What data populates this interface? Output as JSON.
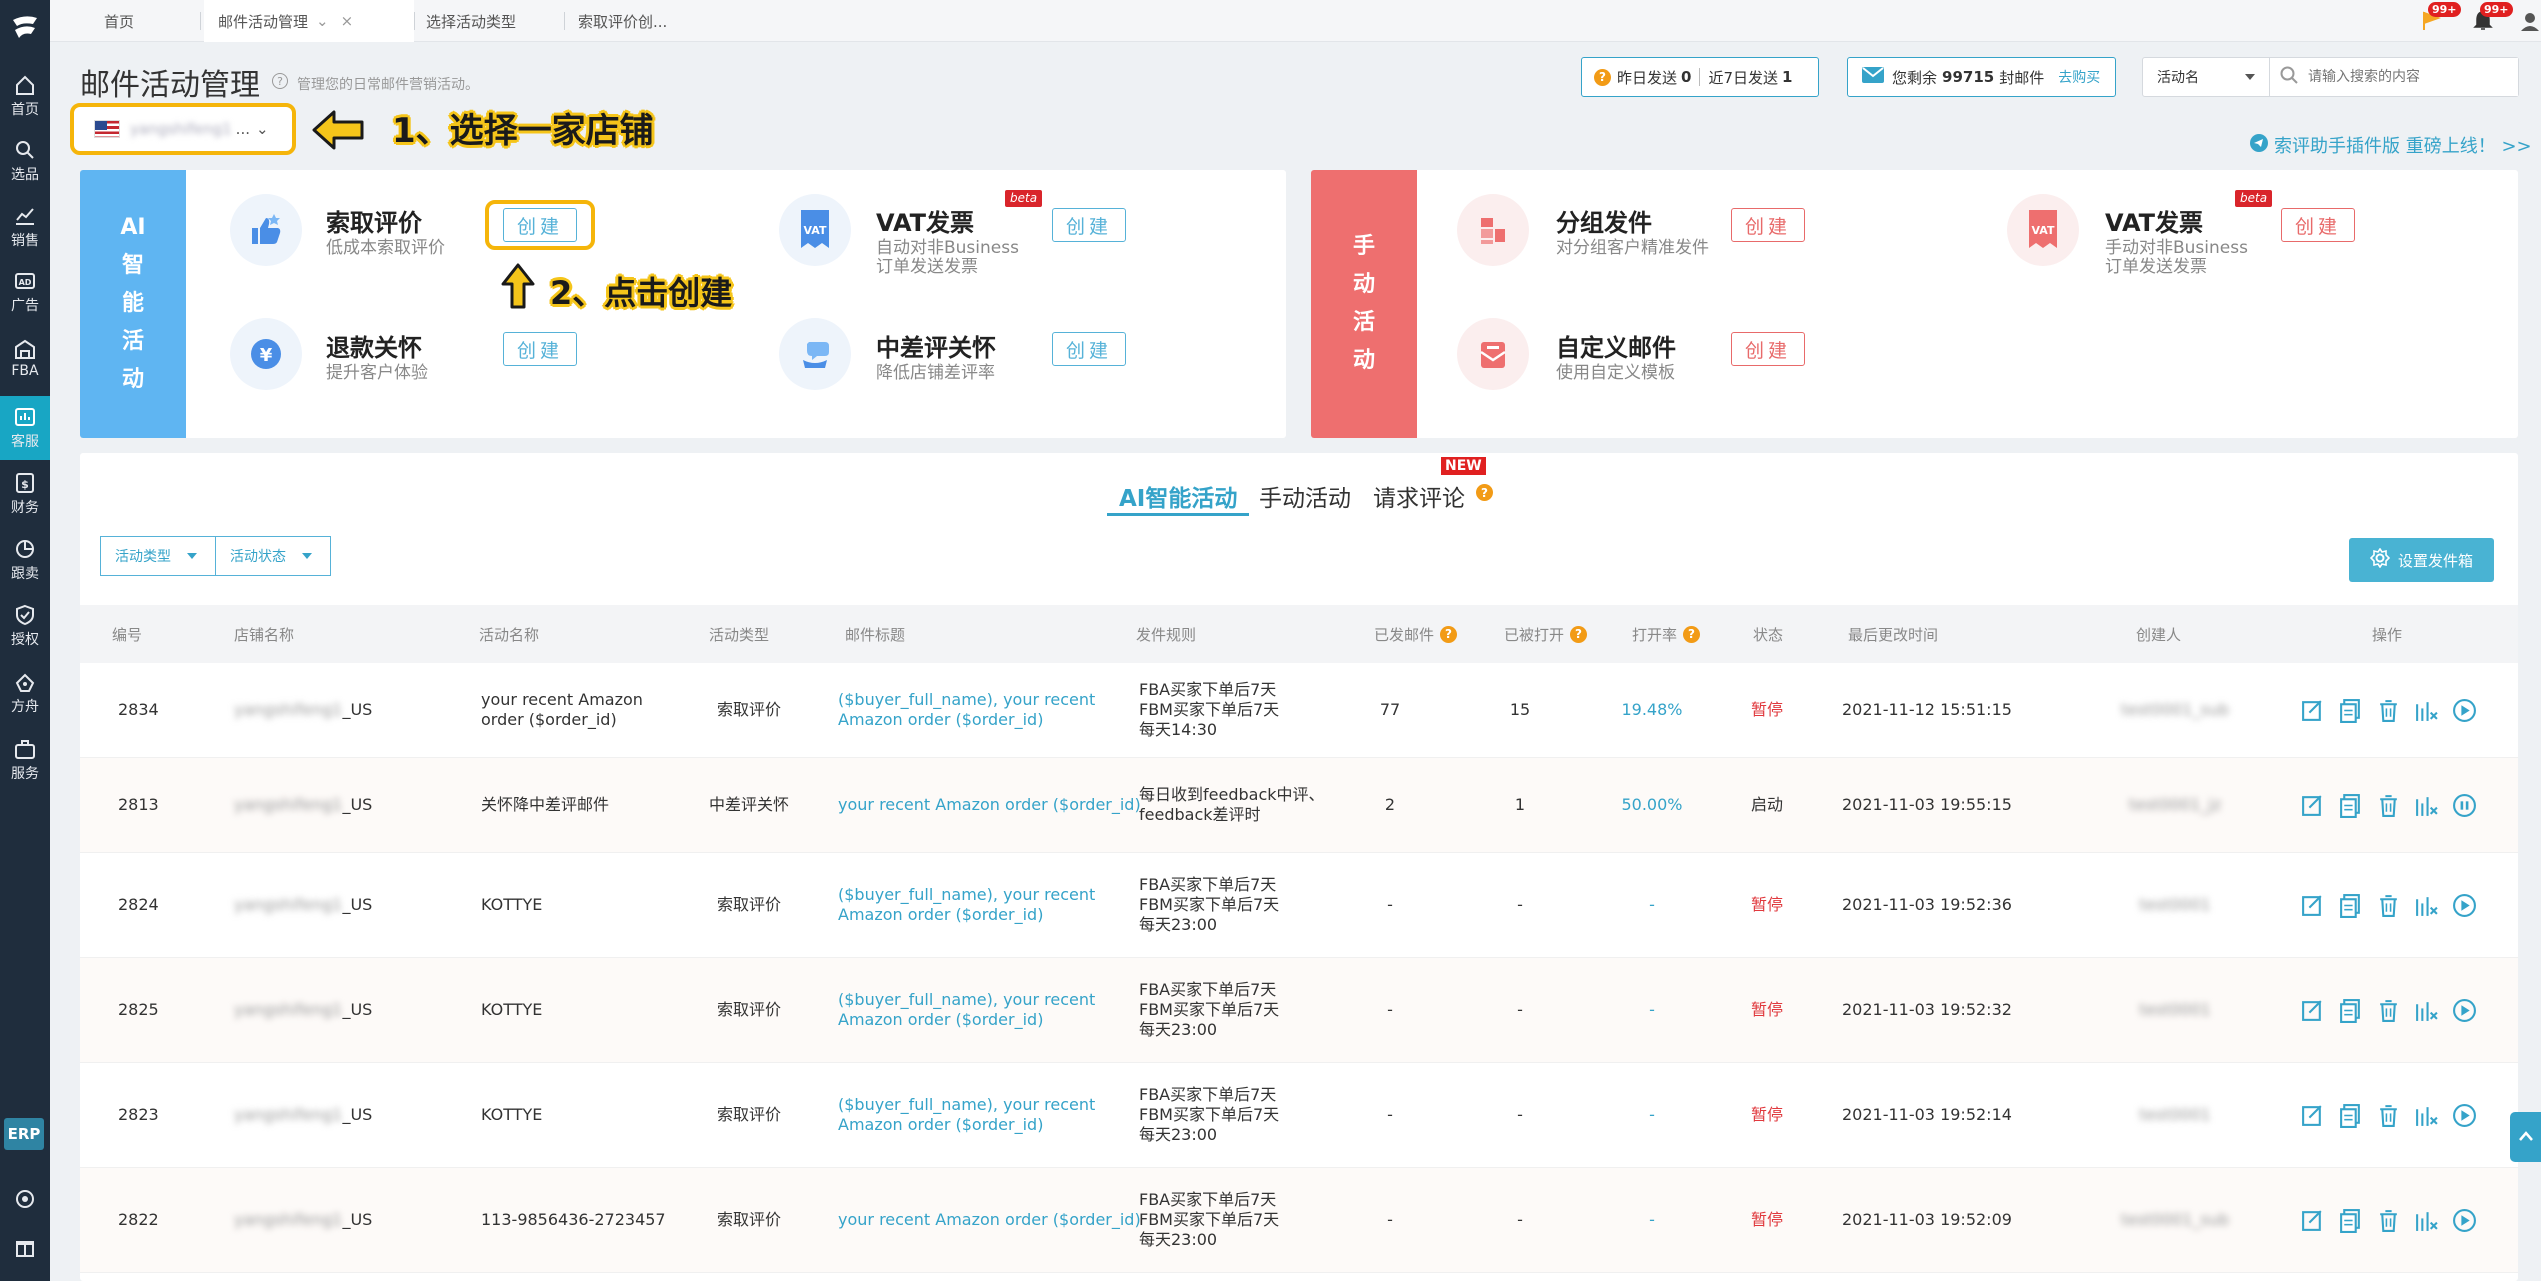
{
  "sidebar": {
    "items": [
      {
        "label": "首页",
        "icon": "home-icon"
      },
      {
        "label": "选品",
        "icon": "search-icon"
      },
      {
        "label": "销售",
        "icon": "chart-icon"
      },
      {
        "label": "广告",
        "icon": "ad-icon"
      },
      {
        "label": "FBA",
        "icon": "warehouse-icon"
      },
      {
        "label": "客服",
        "icon": "service-icon",
        "active": true
      },
      {
        "label": "财务",
        "icon": "finance-icon"
      },
      {
        "label": "跟卖",
        "icon": "pie-icon"
      },
      {
        "label": "授权",
        "icon": "shield-icon"
      },
      {
        "label": "方舟",
        "icon": "ark-icon"
      },
      {
        "label": "服务",
        "icon": "briefcase-icon"
      }
    ],
    "erp_label": "ERP"
  },
  "tabs": [
    {
      "label": "首页"
    },
    {
      "label": "邮件活动管理",
      "active": true
    },
    {
      "label": "选择活动类型"
    },
    {
      "label": "索取评价创..."
    }
  ],
  "notifications": {
    "flag_count": "99+",
    "bell_count": "99+"
  },
  "header": {
    "title": "邮件活动管理",
    "subtitle": "管理您的日常邮件营销活动。",
    "store_name": "yangshifeng1",
    "store_suffix": "..."
  },
  "annotations": {
    "step1": "1、选择一家店铺",
    "step2": "2、点击创建"
  },
  "stats": {
    "yesterday_label": "昨日发送",
    "yesterday_value": "0",
    "week_label": "近7日发送",
    "week_value": "1"
  },
  "mail_quota": {
    "prefix": "您剩余",
    "value": "99715",
    "suffix": "封邮件",
    "buy_label": "去购买"
  },
  "search": {
    "field": "活动名",
    "placeholder": "请输入搜索的内容"
  },
  "promo": "索评助手插件版 重磅上线！ >>",
  "ai_card": {
    "band": [
      "AI",
      "智",
      "能",
      "活",
      "动"
    ],
    "activities": [
      {
        "name": "索取评价",
        "desc": "低成本索取评价",
        "button": "创建"
      },
      {
        "name": "VAT发票",
        "desc": "自动对非Business\n订单发送发票",
        "button": "创建",
        "badge": "beta"
      },
      {
        "name": "退款关怀",
        "desc": "提升客户体验",
        "button": "创建"
      },
      {
        "name": "中差评关怀",
        "desc": "降低店铺差评率",
        "button": "创建"
      }
    ]
  },
  "manual_card": {
    "band": [
      "手",
      "动",
      "活",
      "动"
    ],
    "activities": [
      {
        "name": "分组发件",
        "desc": "对分组客户精准发件",
        "button": "创建"
      },
      {
        "name": "VAT发票",
        "desc": "手动对非Business\n订单发送发票",
        "button": "创建",
        "badge": "beta"
      },
      {
        "name": "自定义邮件",
        "desc": "使用自定义模板",
        "button": "创建"
      }
    ]
  },
  "category_tabs": [
    {
      "label": "AI智能活动",
      "active": true
    },
    {
      "label": "手动活动"
    },
    {
      "label": "请求评论",
      "badge": "NEW"
    }
  ],
  "filters": {
    "type": "活动类型",
    "status": "活动状态",
    "sender_button": "设置发件箱"
  },
  "table": {
    "columns": [
      "编号",
      "店铺名称",
      "活动名称",
      "活动类型",
      "邮件标题",
      "发件规则",
      "已发邮件",
      "已被打开",
      "打开率",
      "状态",
      "最后更改时间",
      "创建人",
      "操作"
    ],
    "rows": [
      {
        "id": "2834",
        "store": "yangshifeng1",
        "store_suffix": "_US",
        "name": "your recent Amazon\norder ($order_id)",
        "type": "索取评价",
        "subject": "($buyer_full_name), your recent\nAmazon order ($order_id)",
        "rule": "FBA买家下单后7天\nFBM买家下单后7天\n每天14:30",
        "sent": "77",
        "opened": "15",
        "rate": "19.48%",
        "status": "暂停",
        "status_color": "#e0393e",
        "modified": "2021-11-12 15:51:15",
        "creator": "test0001_sub"
      },
      {
        "id": "2813",
        "store": "yangshifeng1",
        "store_suffix": "_US",
        "name": "关怀降中差评邮件",
        "type": "中差评关怀",
        "subject": "your recent Amazon order ($order_id)",
        "rule": "每日收到feedback中评、\nfeedback差评时",
        "sent": "2",
        "opened": "1",
        "rate": "50.00%",
        "status": "启动",
        "status_color": "#333333",
        "modified": "2021-11-03 19:55:15",
        "creator": "test0001_jz"
      },
      {
        "id": "2824",
        "store": "yangshifeng1",
        "store_suffix": "_US",
        "name": "KOTTYE",
        "type": "索取评价",
        "subject": "($buyer_full_name), your recent\nAmazon order ($order_id)",
        "rule": "FBA买家下单后7天\nFBM买家下单后7天\n每天23:00",
        "sent": "-",
        "opened": "-",
        "rate": "-",
        "status": "暂停",
        "status_color": "#e0393e",
        "modified": "2021-11-03 19:52:36",
        "creator": "test0001"
      },
      {
        "id": "2825",
        "store": "yangshifeng1",
        "store_suffix": "_US",
        "name": "KOTTYE",
        "type": "索取评价",
        "subject": "($buyer_full_name), your recent\nAmazon order ($order_id)",
        "rule": "FBA买家下单后7天\nFBM买家下单后7天\n每天23:00",
        "sent": "-",
        "opened": "-",
        "rate": "-",
        "status": "暂停",
        "status_color": "#e0393e",
        "modified": "2021-11-03 19:52:32",
        "creator": "test0001"
      },
      {
        "id": "2823",
        "store": "yangshifeng1",
        "store_suffix": "_US",
        "name": "KOTTYE",
        "type": "索取评价",
        "subject": "($buyer_full_name), your recent\nAmazon order ($order_id)",
        "rule": "FBA买家下单后7天\nFBM买家下单后7天\n每天23:00",
        "sent": "-",
        "opened": "-",
        "rate": "-",
        "status": "暂停",
        "status_color": "#e0393e",
        "modified": "2021-11-03 19:52:14",
        "creator": "test0001"
      },
      {
        "id": "2822",
        "store": "yangshifeng1",
        "store_suffix": "_US",
        "name": "113-9856436-2723457",
        "type": "索取评价",
        "subject": "your recent Amazon order ($order_id)",
        "rule": "FBA买家下单后7天\nFBM买家下单后7天\n每天23:00",
        "sent": "-",
        "opened": "-",
        "rate": "-",
        "status": "暂停",
        "status_color": "#e0393e",
        "modified": "2021-11-03 19:52:09",
        "creator": "test0001_sub"
      }
    ]
  },
  "colors": {
    "accent": "#35a3c9",
    "sidebar_bg": "#1f2d3d",
    "ai_band": "#5fb5f2",
    "manual_band": "#ee6f6f",
    "highlight": "#f5b50a",
    "danger": "#e0393e"
  }
}
